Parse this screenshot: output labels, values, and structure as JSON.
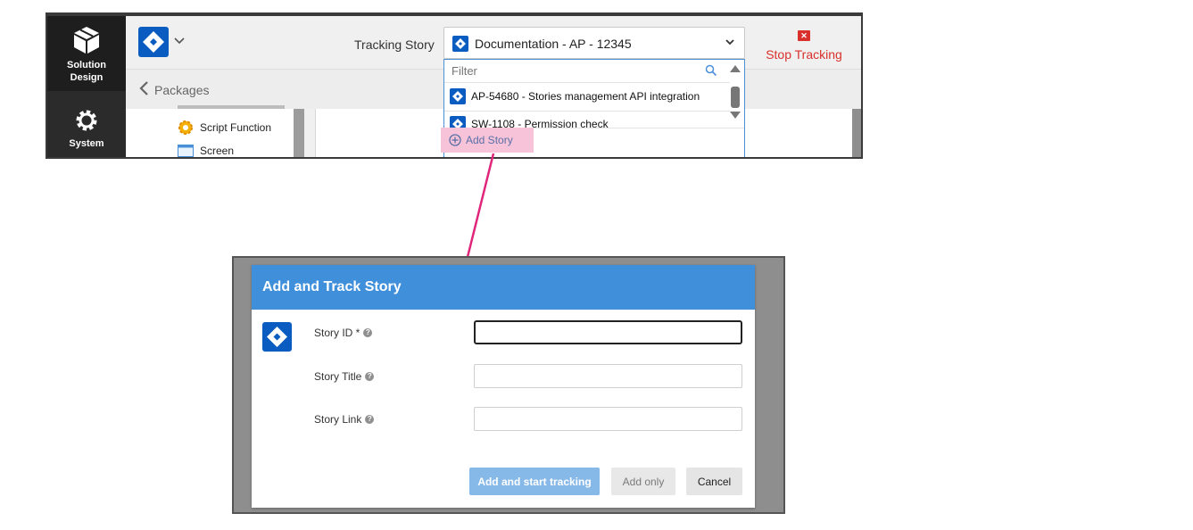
{
  "left_rail": {
    "solution_label_line1": "Solution",
    "solution_label_line2": "Design",
    "system_label": "System",
    "solution_icon": "box-icon",
    "system_icon": "gear-icon"
  },
  "header": {
    "tracking_label": "Tracking Story",
    "selected_story": "Documentation - AP - 12345",
    "stop_tracking_label": "Stop Tracking",
    "stop_icon_glyph": "✕"
  },
  "sub_header": {
    "back_label": "Packages"
  },
  "tree": {
    "items": [
      {
        "label": "Script Function",
        "icon": "script-function-icon"
      },
      {
        "label": "Screen",
        "icon": "screen-icon"
      }
    ]
  },
  "dropdown": {
    "filter_placeholder": "Filter",
    "items": [
      {
        "label": "AP-54680 - Stories management API integration"
      },
      {
        "label": "SW-1108 - Permission check"
      }
    ],
    "add_story_label": "Add Story"
  },
  "dialog": {
    "title": "Add and Track Story",
    "fields": [
      {
        "label": "Story ID *",
        "value": "",
        "help": "?"
      },
      {
        "label": "Story Title",
        "value": "",
        "help": "?"
      },
      {
        "label": "Story Link",
        "value": "",
        "help": "?"
      }
    ],
    "buttons": {
      "primary": "Add and start tracking",
      "add_only": "Add only",
      "cancel": "Cancel"
    }
  },
  "colors": {
    "accent_blue": "#3f8fdb",
    "stop_red": "#d9302b",
    "highlight_pink": "#f6c3d8",
    "arrow_magenta": "#e0267a"
  }
}
